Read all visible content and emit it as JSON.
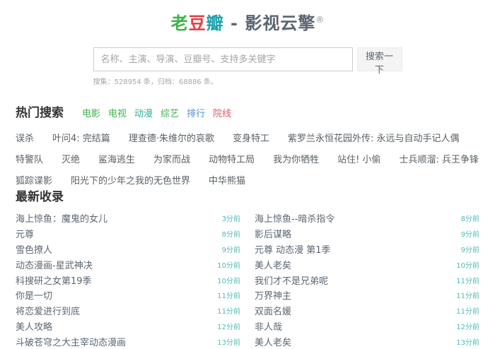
{
  "logo": {
    "chars": [
      {
        "text": "老",
        "color": "#3cb34a"
      },
      {
        "text": "豆",
        "color": "#e23c42"
      },
      {
        "text": "瓣",
        "color": "#1ea3ae"
      }
    ],
    "suffix": " - 影视云擎",
    "badge": "®"
  },
  "search": {
    "placeholder": "名称、主演、导演、豆瓣号、支持多关键字",
    "button_label": "搜索一下",
    "stats": "搜集：528954 条，归档：68886 条。"
  },
  "hot_search": {
    "title": "热门搜索",
    "categories": [
      {
        "label": "电影",
        "color": "#3cb34a"
      },
      {
        "label": "电视",
        "color": "#3cb34a"
      },
      {
        "label": "动漫",
        "color": "#2fae9e"
      },
      {
        "label": "综艺",
        "color": "#3cb34a"
      },
      {
        "label": "排行",
        "color": "#4f8fd0"
      },
      {
        "label": "院线",
        "color": "#e05667"
      }
    ],
    "terms": [
      "误杀",
      "叶问4: 完结篇",
      "理查德·朱维尔的哀歌",
      "变身特工",
      "紫罗兰永恒花园外传: 永远与自动手记人偶",
      "特警队",
      "灭绝",
      "鲨海逃生",
      "为家而战",
      "动物特工局",
      "我为你牺牲",
      "站住! 小偷",
      "士兵顺溜: 兵王争锋",
      "狐踪谍影",
      "阳光下的少年之我的无色世界",
      "中华熊猫"
    ]
  },
  "latest": {
    "title": "最新收录",
    "left": [
      {
        "title": "海上惊鱼：魔鬼的女儿",
        "time": "3分前"
      },
      {
        "title": "元尊",
        "time": "8分前"
      },
      {
        "title": "雪色撩人",
        "time": "9分前"
      },
      {
        "title": "动态漫画-星武神决",
        "time": "10分前"
      },
      {
        "title": "科搜研之女第19季",
        "time": "10分前"
      },
      {
        "title": "你是一切",
        "time": "11分前"
      },
      {
        "title": "将恋爱进行到底",
        "time": "11分前"
      },
      {
        "title": "美人攻略",
        "time": "12分前"
      },
      {
        "title": "斗破苍穹之大主宰动态漫画",
        "time": "13分前"
      }
    ],
    "right": [
      {
        "title": "海上惊鱼--暗杀指令",
        "time": "8分前"
      },
      {
        "title": "影后谋略",
        "time": "9分前"
      },
      {
        "title": "元尊 动态漫 第1季",
        "time": "9分前"
      },
      {
        "title": "美人老矣",
        "time": "10分前"
      },
      {
        "title": "我们才不是兄弟呢",
        "time": "11分前"
      },
      {
        "title": "万界神主",
        "time": "11分前"
      },
      {
        "title": "双面名媛",
        "time": "11分前"
      },
      {
        "title": "非人哉",
        "time": "12分前"
      },
      {
        "title": "美人老矣",
        "time": "13分前"
      }
    ]
  }
}
